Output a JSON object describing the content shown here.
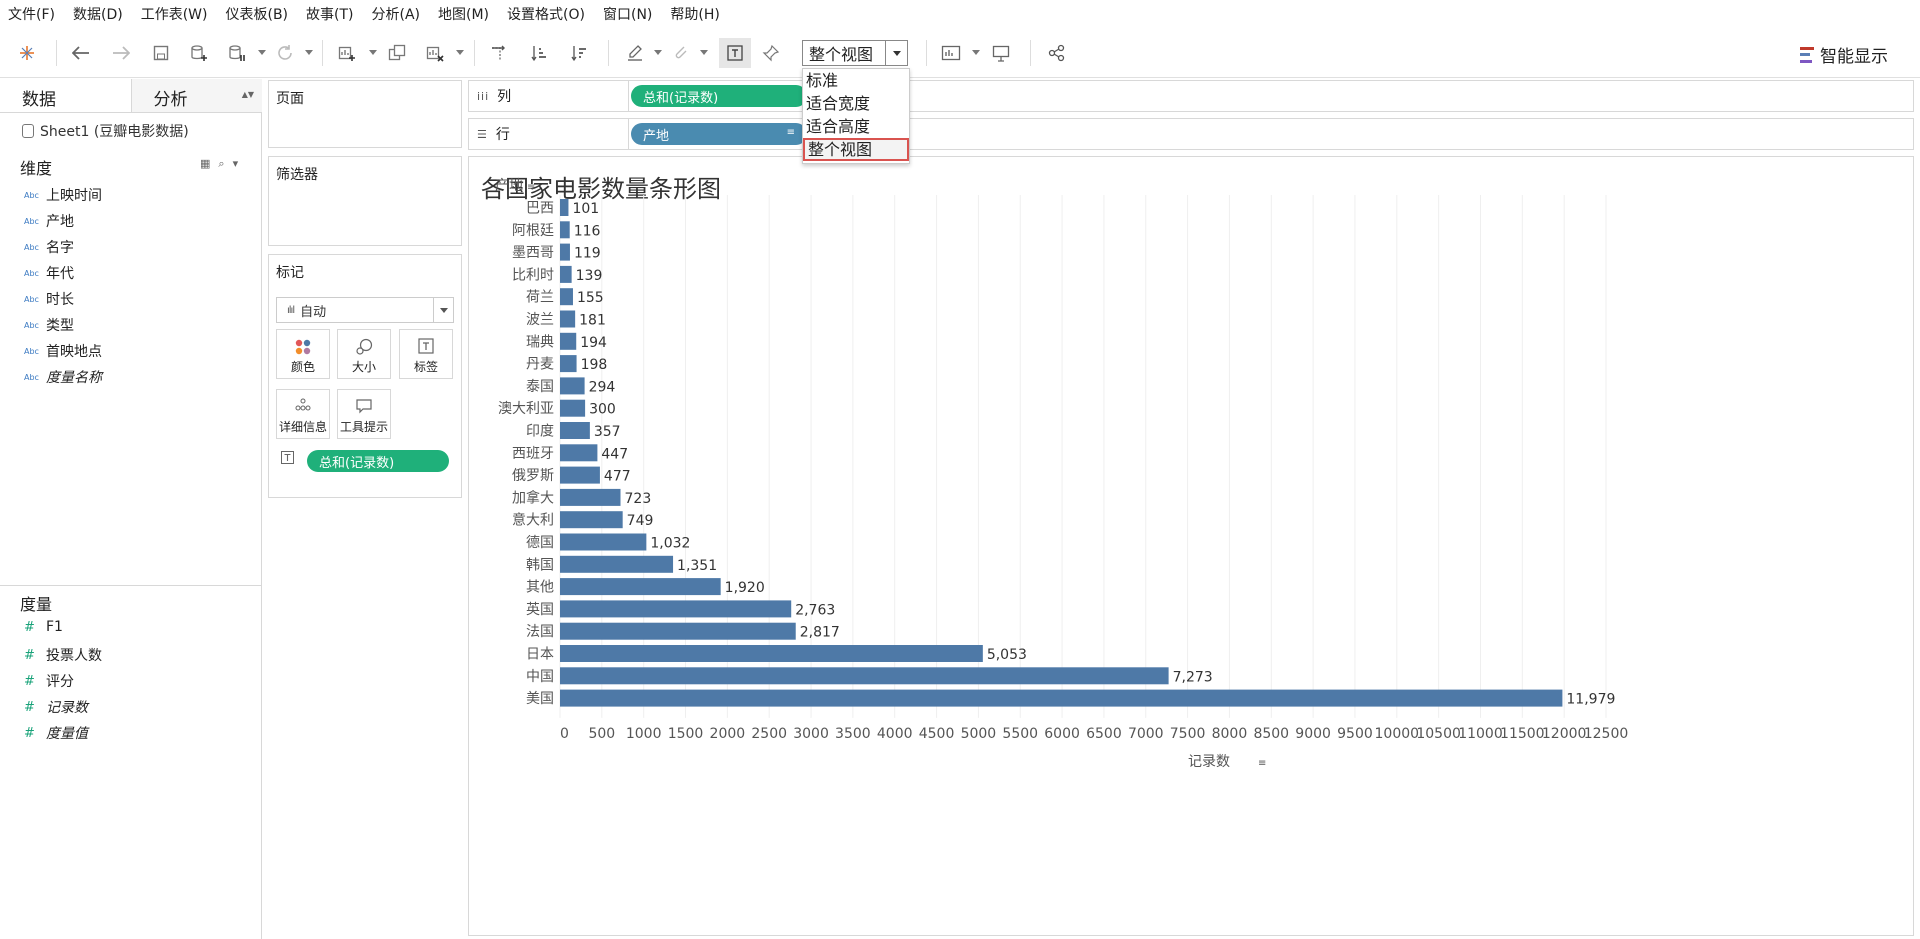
{
  "menu": [
    "文件(F)",
    "数据(D)",
    "工作表(W)",
    "仪表板(B)",
    "故事(T)",
    "分析(A)",
    "地图(M)",
    "设置格式(O)",
    "窗口(N)",
    "帮助(H)"
  ],
  "toolbar": {
    "view_select": "整个视图",
    "smart_show": "智能显示"
  },
  "view_dropdown": [
    "标准",
    "适合宽度",
    "适合高度",
    "整个视图"
  ],
  "left_pane": {
    "tabs": [
      "数据",
      "分析"
    ],
    "datasource": "Sheet1 (豆瓣电影数据)",
    "dimensions_title": "维度",
    "dimension_type": "Abc",
    "dimensions": [
      "上映时间",
      "产地",
      "名字",
      "年代",
      "时长",
      "类型",
      "首映地点",
      "度量名称"
    ],
    "measures_title": "度量",
    "measure_type": "#",
    "measures": [
      "F1",
      "投票人数",
      "评分",
      "记录数",
      "度量值"
    ]
  },
  "cards": {
    "pages": "页面",
    "filters": "筛选器",
    "marks": "标记",
    "marks_type": "自动",
    "mark_buttons": [
      "颜色",
      "大小",
      "标签",
      "详细信息",
      "工具提示"
    ],
    "label_pill": "总和(记录数)"
  },
  "shelves": {
    "columns_label": "列",
    "columns_pill": "总和(记录数)",
    "rows_label": "行",
    "rows_pill": "产地"
  },
  "chart_data": {
    "type": "bar",
    "orientation": "horizontal",
    "title": "各国家电影数量条形图",
    "ylabel": "产地",
    "xlabel": "记录数",
    "categories": [
      "巴西",
      "阿根廷",
      "墨西哥",
      "比利时",
      "荷兰",
      "波兰",
      "瑞典",
      "丹麦",
      "泰国",
      "澳大利亚",
      "印度",
      "西班牙",
      "俄罗斯",
      "加拿大",
      "意大利",
      "德国",
      "韩国",
      "其他",
      "英国",
      "法国",
      "日本",
      "中国",
      "美国"
    ],
    "values": [
      101,
      116,
      119,
      139,
      155,
      181,
      194,
      198,
      294,
      300,
      357,
      447,
      477,
      723,
      749,
      1032,
      1351,
      1920,
      2763,
      2817,
      5053,
      7273,
      11979
    ],
    "data_labels": [
      "101",
      "116",
      "119",
      "139",
      "155",
      "181",
      "194",
      "198",
      "294",
      "300",
      "357",
      "447",
      "477",
      "723",
      "749",
      "1,032",
      "1,351",
      "1,920",
      "2,763",
      "2,817",
      "5,053",
      "7,273",
      "11,979"
    ],
    "xlim": [
      0,
      12500
    ],
    "xticks": [
      0,
      500,
      1000,
      1500,
      2000,
      2500,
      3000,
      3500,
      4000,
      4500,
      5000,
      5500,
      6000,
      6500,
      7000,
      7500,
      8000,
      8500,
      9000,
      9500,
      10000,
      10500,
      11000,
      11500,
      12000,
      12500
    ],
    "bar_color": "#4e79a7",
    "grid": true
  }
}
